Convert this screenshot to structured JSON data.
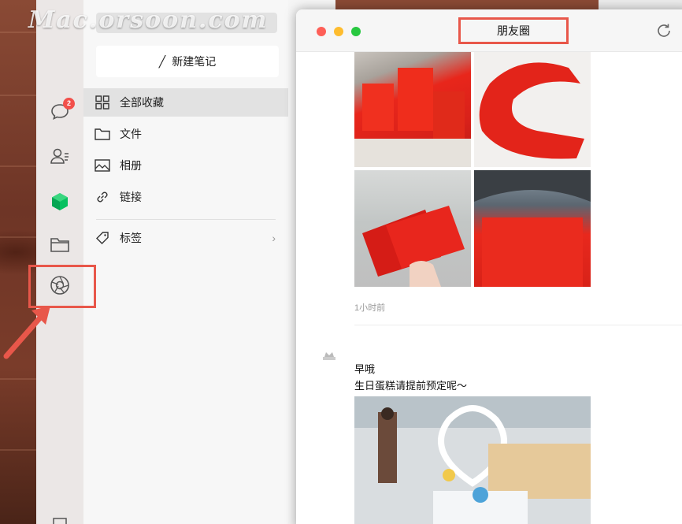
{
  "watermark": "Mac.orsoon.com",
  "rail": {
    "chat_badge": "2"
  },
  "panel": {
    "new_note_label": "新建笔记",
    "items": [
      {
        "label": "全部收藏",
        "icon": "grid-icon"
      },
      {
        "label": "文件",
        "icon": "folder-icon"
      },
      {
        "label": "相册",
        "icon": "image-icon"
      },
      {
        "label": "链接",
        "icon": "link-icon"
      },
      {
        "label": "标签",
        "icon": "tag-icon"
      }
    ]
  },
  "moments": {
    "title": "朋友圈",
    "post1_time": "1小时前",
    "post2_line1": "早哦",
    "post2_line2": "生日蛋糕请提前预定呢～"
  },
  "colors": {
    "accent_red": "#e8574a",
    "badge_red": "#f24f4a",
    "wechat_green": "#07c160"
  }
}
